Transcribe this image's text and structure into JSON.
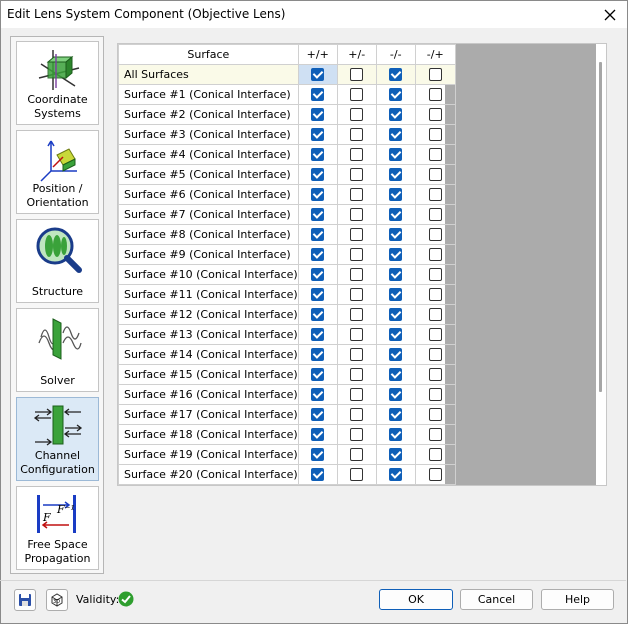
{
  "window": {
    "title": "Edit Lens System Component (Objective Lens)"
  },
  "sidebar": {
    "items": [
      {
        "label": "Coordinate Systems",
        "icon": "coordinate-systems-icon"
      },
      {
        "label": "Position / Orientation",
        "icon": "position-orientation-icon"
      },
      {
        "label": "Structure",
        "icon": "structure-icon"
      },
      {
        "label": "Solver",
        "icon": "solver-icon"
      },
      {
        "label": "Channel Configuration",
        "icon": "channel-configuration-icon",
        "selected": true
      },
      {
        "label": "Free Space Propagation",
        "icon": "free-space-propagation-icon"
      }
    ]
  },
  "grid": {
    "headers": [
      "Surface",
      "+/+",
      "+/-",
      "-/-",
      "-/+"
    ],
    "rows": [
      {
        "name": "All Surfaces",
        "checks": [
          true,
          false,
          true,
          false
        ]
      },
      {
        "name": "Surface #1 (Conical Interface)",
        "checks": [
          true,
          false,
          true,
          false
        ]
      },
      {
        "name": "Surface #2 (Conical Interface)",
        "checks": [
          true,
          false,
          true,
          false
        ]
      },
      {
        "name": "Surface #3 (Conical Interface)",
        "checks": [
          true,
          false,
          true,
          false
        ]
      },
      {
        "name": "Surface #4 (Conical Interface)",
        "checks": [
          true,
          false,
          true,
          false
        ]
      },
      {
        "name": "Surface #5 (Conical Interface)",
        "checks": [
          true,
          false,
          true,
          false
        ]
      },
      {
        "name": "Surface #6 (Conical Interface)",
        "checks": [
          true,
          false,
          true,
          false
        ]
      },
      {
        "name": "Surface #7 (Conical Interface)",
        "checks": [
          true,
          false,
          true,
          false
        ]
      },
      {
        "name": "Surface #8 (Conical Interface)",
        "checks": [
          true,
          false,
          true,
          false
        ]
      },
      {
        "name": "Surface #9 (Conical Interface)",
        "checks": [
          true,
          false,
          true,
          false
        ]
      },
      {
        "name": "Surface #10 (Conical Interface)",
        "checks": [
          true,
          false,
          true,
          false
        ]
      },
      {
        "name": "Surface #11 (Conical Interface)",
        "checks": [
          true,
          false,
          true,
          false
        ]
      },
      {
        "name": "Surface #12 (Conical Interface)",
        "checks": [
          true,
          false,
          true,
          false
        ]
      },
      {
        "name": "Surface #13 (Conical Interface)",
        "checks": [
          true,
          false,
          true,
          false
        ]
      },
      {
        "name": "Surface #14 (Conical Interface)",
        "checks": [
          true,
          false,
          true,
          false
        ]
      },
      {
        "name": "Surface #15 (Conical Interface)",
        "checks": [
          true,
          false,
          true,
          false
        ]
      },
      {
        "name": "Surface #16 (Conical Interface)",
        "checks": [
          true,
          false,
          true,
          false
        ]
      },
      {
        "name": "Surface #17 (Conical Interface)",
        "checks": [
          true,
          false,
          true,
          false
        ]
      },
      {
        "name": "Surface #18 (Conical Interface)",
        "checks": [
          true,
          false,
          true,
          false
        ]
      },
      {
        "name": "Surface #19 (Conical Interface)",
        "checks": [
          true,
          false,
          true,
          false
        ]
      },
      {
        "name": "Surface #20 (Conical Interface)",
        "checks": [
          true,
          false,
          true,
          false
        ]
      }
    ]
  },
  "footer": {
    "validity_label": "Validity:",
    "ok_label": "OK",
    "cancel_label": "Cancel",
    "help_label": "Help"
  },
  "colors": {
    "accent": "#0f5fb8",
    "selected_nav": "#dbe9f6",
    "all_row": "#fafae8",
    "valid": "#2e9e2e"
  }
}
